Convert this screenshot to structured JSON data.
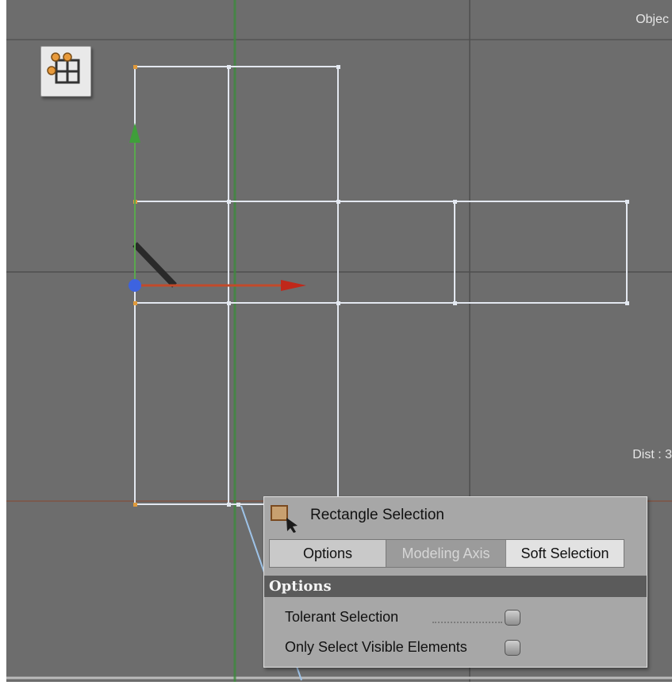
{
  "viewport": {
    "label_top_right": "Objec",
    "label_right": "Dist : 3",
    "colors": {
      "background": "#6d6d6d",
      "grid_line": "#4a4a4a",
      "wire": "#e8edf5",
      "axis_x": "#c0391f",
      "axis_y": "#3fa33a",
      "axis_z": "#2b2b2b",
      "world_axis_green": "#3a8f3a",
      "world_axis_red": "#7a4a3a"
    },
    "camera_icon": "view-mode-icon"
  },
  "tool_panel": {
    "title": "Rectangle Selection",
    "tool_icon": "rectangle-selection-icon",
    "tabs": [
      {
        "label": "Options",
        "state": "active"
      },
      {
        "label": "Modeling Axis",
        "state": "disabled"
      },
      {
        "label": "Soft Selection",
        "state": "enabled"
      }
    ],
    "section_header": "Options",
    "options": [
      {
        "label": "Tolerant Selection",
        "checked": false
      },
      {
        "label": "Only Select Visible Elements",
        "checked": false
      }
    ]
  }
}
